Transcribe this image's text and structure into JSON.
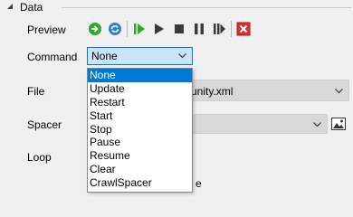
{
  "section": {
    "title": "Data",
    "collapsed": false
  },
  "labels": {
    "preview": "Preview",
    "command": "Command",
    "file": "File",
    "spacer": "Spacer",
    "loop": "Loop"
  },
  "toolbar": {
    "buttons": [
      {
        "name": "refresh-button",
        "icon": "green-circular-arrow-icon"
      },
      {
        "name": "sync-button",
        "icon": "blue-sync-icon"
      },
      {
        "name": "play-from-start-button",
        "icon": "green-skip-play-icon"
      },
      {
        "name": "play-button",
        "icon": "play-icon"
      },
      {
        "name": "stop-button",
        "icon": "stop-icon"
      },
      {
        "name": "pause-button",
        "icon": "pause-icon"
      },
      {
        "name": "resume-button",
        "icon": "resume-icon"
      },
      {
        "name": "close-button",
        "icon": "red-x-icon"
      }
    ]
  },
  "command": {
    "value": "None",
    "options": [
      "None",
      "Update",
      "Restart",
      "Start",
      "Stop",
      "Pause",
      "Resume",
      "Clear",
      "CrawlSpacer"
    ],
    "highlighted_index": 0
  },
  "file": {
    "value": "munity.xml"
  },
  "spacer": {
    "value": ""
  },
  "loop": {
    "partial_text": "e"
  },
  "colors": {
    "accent": "#0078d7",
    "combo_focus_bg": "#cce4f7",
    "disabled_bg": "#d8d8d8",
    "play_green": "#2ea82e",
    "close_red": "#d9322c"
  }
}
